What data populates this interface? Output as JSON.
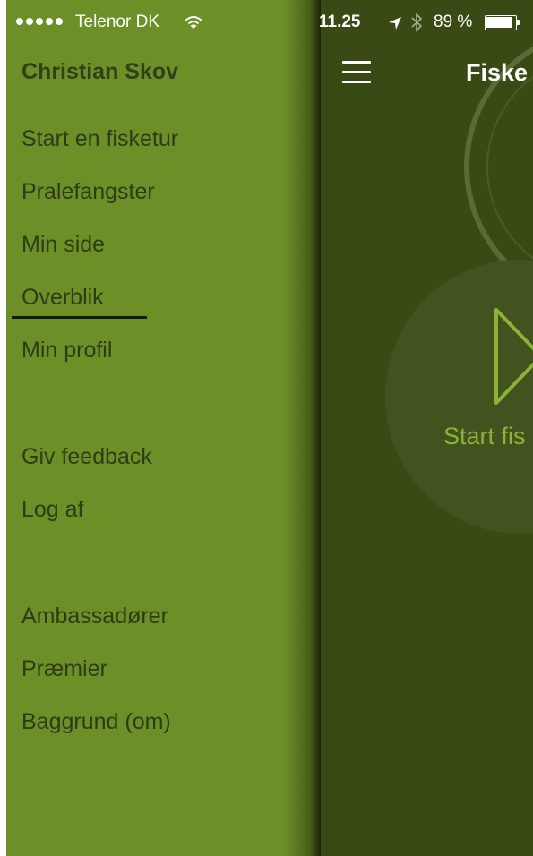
{
  "status_bar": {
    "carrier": "Telenor DK",
    "time": "11.25",
    "battery": "89 %",
    "icons": [
      "signal-dots-icon",
      "wifi-icon",
      "location-arrow-icon",
      "bluetooth-icon",
      "battery-icon"
    ]
  },
  "main": {
    "title": "Fiske",
    "start_label": "Start fis",
    "icons": [
      "hamburger-menu-icon",
      "play-icon"
    ]
  },
  "drawer": {
    "user_name": "Christian Skov",
    "active_item": "Overblik",
    "items": [
      {
        "label": "Start en fisketur"
      },
      {
        "label": "Pralefangster"
      },
      {
        "label": "Min side"
      },
      {
        "label": "Overblik"
      },
      {
        "label": "Min profil"
      },
      {
        "label": "Giv feedback"
      },
      {
        "label": "Log af"
      },
      {
        "label": "Ambassadører"
      },
      {
        "label": "Præmier"
      },
      {
        "label": "Baggrund (om)"
      }
    ]
  },
  "colors": {
    "drawer_bg": "#6c9027",
    "main_bg": "#3a4a14",
    "accent": "#8bb338",
    "text_dark": "#2f3b16"
  }
}
